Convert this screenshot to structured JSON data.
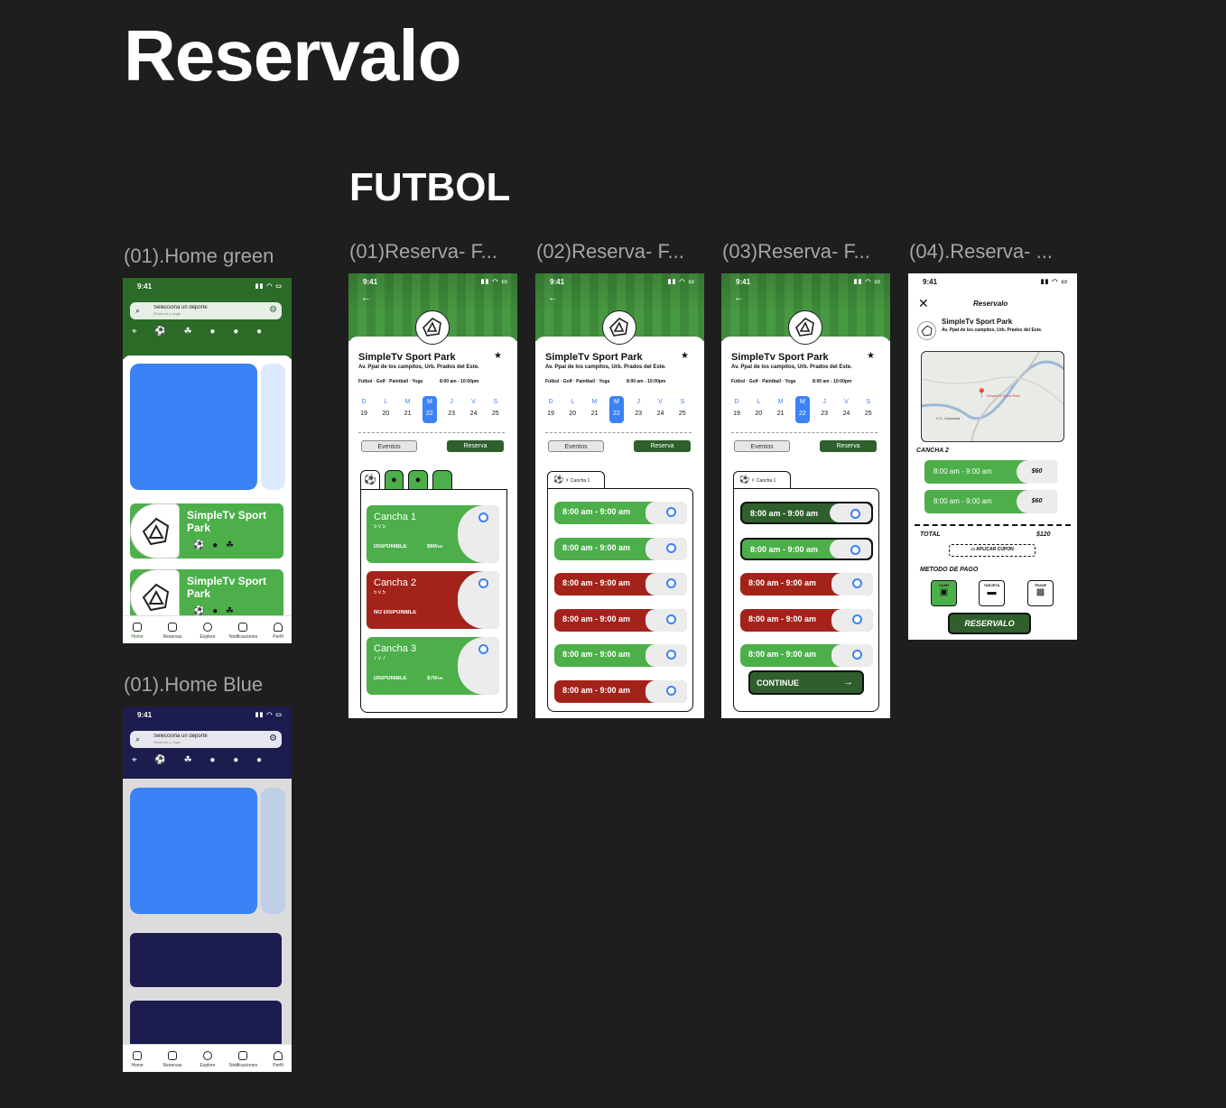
{
  "page": {
    "title": "Reservalo",
    "section": "FUTBOL"
  },
  "frame_labels": {
    "home_green": "(01).Home green",
    "home_blue": "(01).Home Blue",
    "reserva1": "(01)Reserva- F...",
    "reserva2": "(02)Reserva- F...",
    "reserva3": "(03)Reserva- F...",
    "reserva4": "(04).Reserva- ..."
  },
  "status_time": "9:41",
  "home": {
    "search_title": "Selecciona un deporte",
    "search_sub": "Reservar y Jugar",
    "card_title": "SimpleTv Sport Park",
    "tabs": [
      "Home",
      "Reservas",
      "Explore",
      "Notificaciones",
      "Perfil"
    ]
  },
  "venue": {
    "name": "SimpleTv Sport Park",
    "address": "Av. Ppal de los campitos, Urb. Prados del Este.",
    "sports": "Fútbol · Golf · Paintball · Yoga",
    "hours": "8:00 am - 10:00pm",
    "days": [
      {
        "l": "D",
        "n": "19"
      },
      {
        "l": "L",
        "n": "20"
      },
      {
        "l": "M",
        "n": "21"
      },
      {
        "l": "M",
        "n": "22",
        "sel": true
      },
      {
        "l": "J",
        "n": "23"
      },
      {
        "l": "V",
        "n": "24"
      },
      {
        "l": "S",
        "n": "25"
      }
    ],
    "btn_events": "Eventos",
    "btn_reserve": "Reserva"
  },
  "canchas": [
    {
      "name": "Cancha 1",
      "type": "5 v 5",
      "status": "DISPONIBLE",
      "price": "$60/",
      "unit": "HR",
      "state": "ok"
    },
    {
      "name": "Cancha 2",
      "type": "5 v 5",
      "status": "NO DISPONIBLE",
      "price": "",
      "unit": "",
      "state": "no"
    },
    {
      "name": "Cancha 3",
      "type": "7 v 7",
      "status": "DISPONIBLE",
      "price": "$70/",
      "unit": "HR",
      "state": "ok"
    }
  ],
  "slot_label": "8:00 am - 9:00 am",
  "cancha_tab": "Cancha 1",
  "slots2": [
    "ok",
    "ok",
    "no",
    "no",
    "ok",
    "no"
  ],
  "slots3": [
    "sel",
    "selw",
    "no",
    "no",
    "ok"
  ],
  "continue_label": "CONTINUE",
  "checkout": {
    "header": "Reservalo",
    "map_label": "SimpleTv Sport Park",
    "map_label2": "C.C. Concresa",
    "cancha": "CANCHA 2",
    "slots": [
      {
        "time": "8:00 am - 9:00 am",
        "price": "$60"
      },
      {
        "time": "8:00 am - 9:00 am",
        "price": "$60"
      }
    ],
    "total_label": "TOTAL",
    "total": "$120",
    "coupon": "APLICAR CUPON",
    "payment_title": "METODO DE PAGO",
    "payments": [
      "CASH",
      "TARJETA",
      "TRANF"
    ],
    "cta": "RESERVALO"
  },
  "colors": {
    "green": "#4caf4a",
    "dark_green": "#2f5f2c",
    "red": "#a3231b",
    "blue": "#3b82f6",
    "navy": "#1c1c4e",
    "bg": "#1e1e1e"
  }
}
